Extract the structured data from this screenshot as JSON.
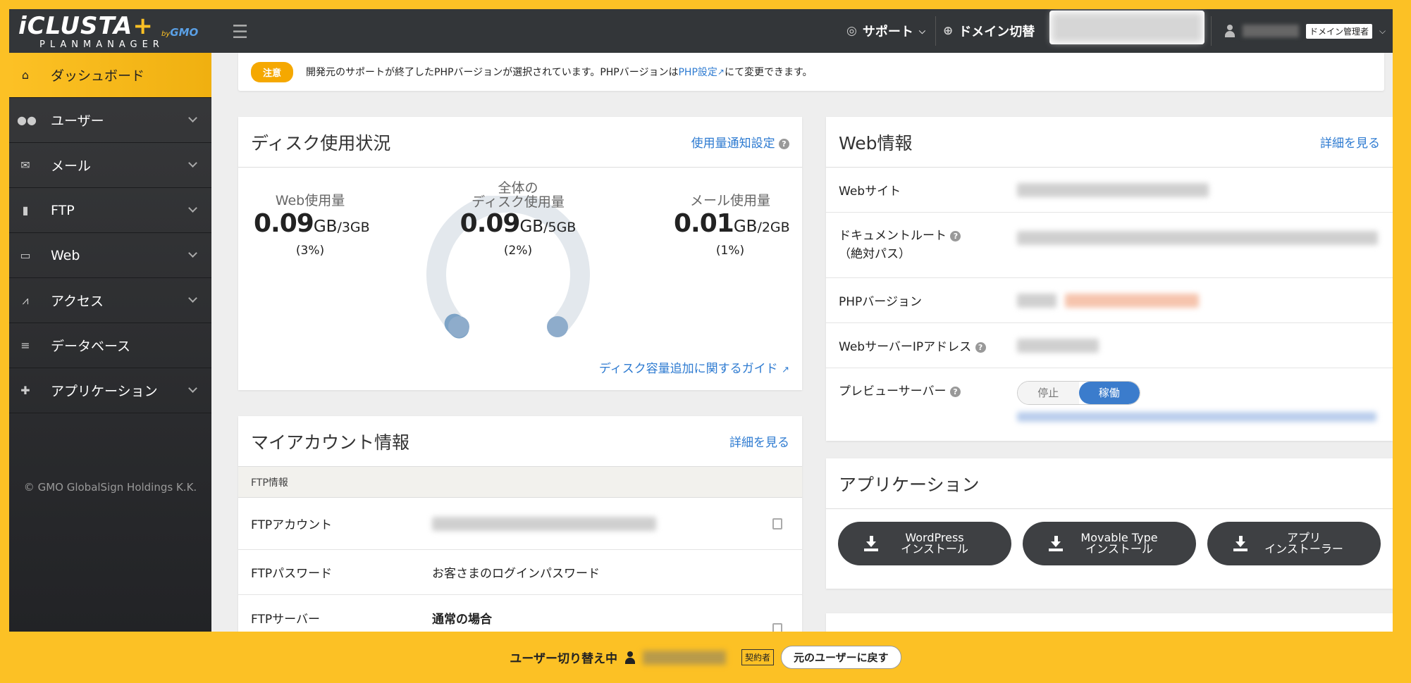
{
  "header": {
    "logo_main": "iCLUSTA",
    "logo_plus": "+",
    "logo_by": "by",
    "logo_gmo": "GMO",
    "logo_sub": "PLANMANAGER",
    "support_label": "サポート",
    "domain_switch_label": "ドメイン切替",
    "role_badge": "ドメイン管理者"
  },
  "sidebar": {
    "items": [
      {
        "label": "ダッシュボード",
        "icon": "home-icon"
      },
      {
        "label": "ユーザー",
        "icon": "users-icon"
      },
      {
        "label": "メール",
        "icon": "envelope-icon"
      },
      {
        "label": "FTP",
        "icon": "file-upload-icon"
      },
      {
        "label": "Web",
        "icon": "window-icon"
      },
      {
        "label": "アクセス",
        "icon": "chart-icon"
      },
      {
        "label": "データベース",
        "icon": "database-icon"
      },
      {
        "label": "アプリケーション",
        "icon": "puzzle-icon"
      }
    ],
    "copyright": "© GMO GlobalSign Holdings K.K."
  },
  "notice": {
    "badge": "注意",
    "text_before": "開発元のサポートが終了したPHPバージョンが選択されています。PHPバージョンは",
    "link": "PHP設定",
    "text_after": "にて変更できます。"
  },
  "disk": {
    "title": "ディスク使用状況",
    "settings_link": "使用量通知設定",
    "web": {
      "label": "Web使用量",
      "value": "0.09",
      "unit": "GB",
      "total": "/3GB",
      "pct": "(3%)"
    },
    "total": {
      "label1": "全体の",
      "label2": "ディスク使用量",
      "value": "0.09",
      "unit": "GB",
      "total": "/5GB",
      "pct": "(2%)",
      "ratio": 0.02
    },
    "mail": {
      "label": "メール使用量",
      "value": "0.01",
      "unit": "GB",
      "total": "/2GB",
      "pct": "(1%)"
    },
    "guide_link": "ディスク容量追加に関するガイド"
  },
  "account": {
    "title": "マイアカウント情報",
    "detail_link": "詳細を見る",
    "section": "FTP情報",
    "rows": [
      {
        "key": "FTPアカウント"
      },
      {
        "key": "FTPパスワード",
        "value": "お客さまのログインパスワード"
      },
      {
        "key": "FTPサーバー",
        "value": "通常の場合"
      }
    ]
  },
  "web_info": {
    "title": "Web情報",
    "detail_link": "詳細を見る",
    "rows": [
      {
        "key": "Webサイト"
      },
      {
        "key": "ドキュメントルート",
        "sub": "（絶対パス）"
      },
      {
        "key": "PHPバージョン"
      },
      {
        "key": "WebサーバーIPアドレス"
      },
      {
        "key": "プレビューサーバー"
      }
    ],
    "toggle_off": "停止",
    "toggle_on": "稼働"
  },
  "apps": {
    "title": "アプリケーション",
    "buttons": [
      {
        "line1": "WordPress",
        "line2": "インストール"
      },
      {
        "line1": "Movable Type",
        "line2": "インストール"
      },
      {
        "line1": "アプリ",
        "line2": "インストーラー"
      }
    ]
  },
  "bottom": {
    "switching_label": "ユーザー切り替え中",
    "contract_badge": "契約者",
    "back_button": "元のユーザーに戻す"
  },
  "colors": {
    "accent": "#fcc125",
    "link": "#2e7bd1",
    "dark": "#333639",
    "toggle_on": "#3b7ccc"
  }
}
